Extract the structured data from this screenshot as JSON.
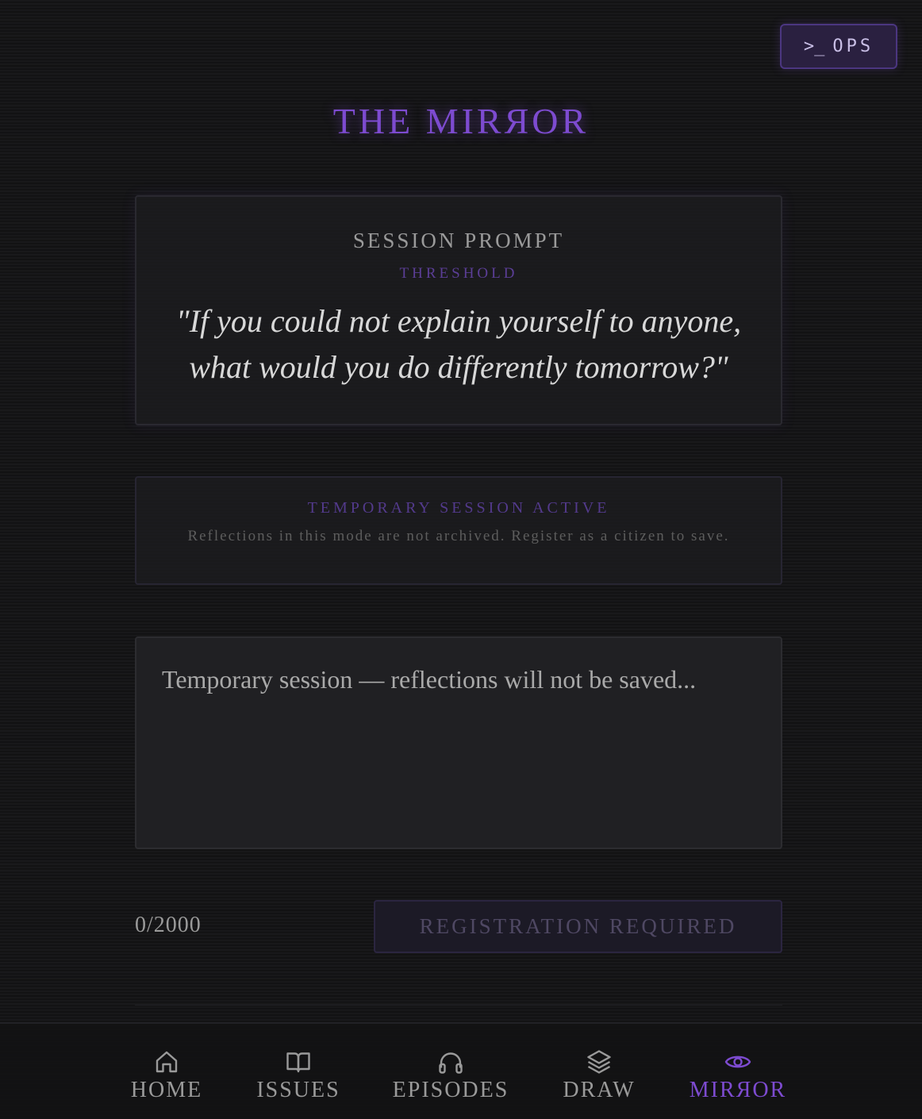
{
  "ops": {
    "prompt_symbol": ">_",
    "label": "OPS"
  },
  "title": "THE MIRЯOR",
  "session_prompt": {
    "label": "SESSION PROMPT",
    "category": "THRESHOLD",
    "quote": "\"If you could not explain yourself to anyone, what would you do differently tomorrow?\""
  },
  "notice": {
    "title": "TEMPORARY SESSION ACTIVE",
    "text": "Reflections in this mode are not archived. Register as a citizen to save."
  },
  "reflection": {
    "placeholder": "Temporary session — reflections will not be saved..."
  },
  "counter": "0/2000",
  "submit_label": "REGISTRATION REQUIRED",
  "nav": {
    "items": [
      {
        "label": "HOME",
        "icon": "home-icon"
      },
      {
        "label": "ISSUES",
        "icon": "book-icon"
      },
      {
        "label": "EPISODES",
        "icon": "headphones-icon"
      },
      {
        "label": "DRAW",
        "icon": "layers-icon"
      },
      {
        "label": "MIRЯOR",
        "icon": "eye-icon",
        "active": true
      }
    ]
  },
  "colors": {
    "accent": "#7d4bd0",
    "background": "#141416",
    "card_border": "#2a2930"
  }
}
